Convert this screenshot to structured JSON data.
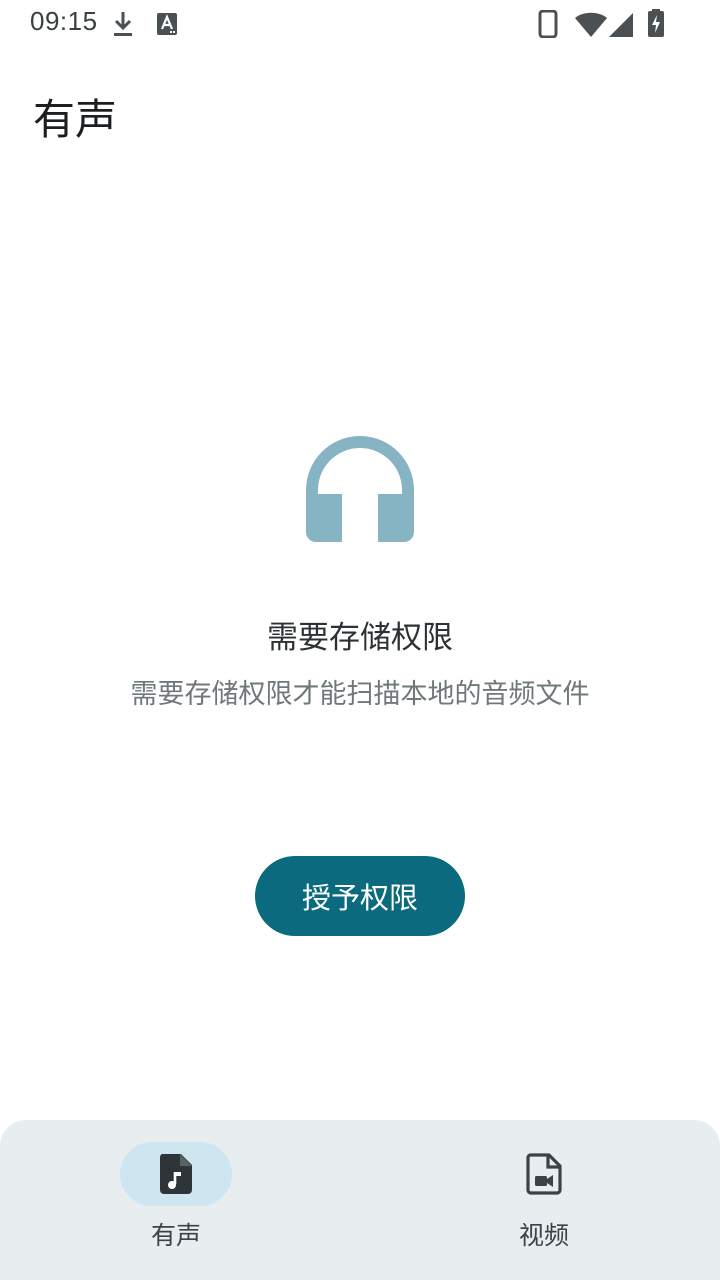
{
  "status_bar": {
    "time": "09:15",
    "left_icons": [
      "download-icon",
      "a-keyboard-icon"
    ],
    "right_icons": [
      "phone-icon",
      "wifi-icon",
      "signal-icon",
      "battery-charging-icon"
    ]
  },
  "header": {
    "title": "有声"
  },
  "empty_state": {
    "icon": "headphones-icon",
    "title": "需要存储权限",
    "description": "需要存储权限才能扫描本地的音频文件",
    "button_label": "授予权限"
  },
  "bottom_nav": {
    "items": [
      {
        "label": "有声",
        "icon": "audio-file-icon",
        "selected": true
      },
      {
        "label": "视频",
        "icon": "video-file-icon",
        "selected": false
      }
    ]
  },
  "colors": {
    "accent": "#0b6a7e",
    "headphones": "#86b4c2",
    "nav_background": "#e8edf0",
    "nav_selected_pill": "#cfe5ef"
  }
}
